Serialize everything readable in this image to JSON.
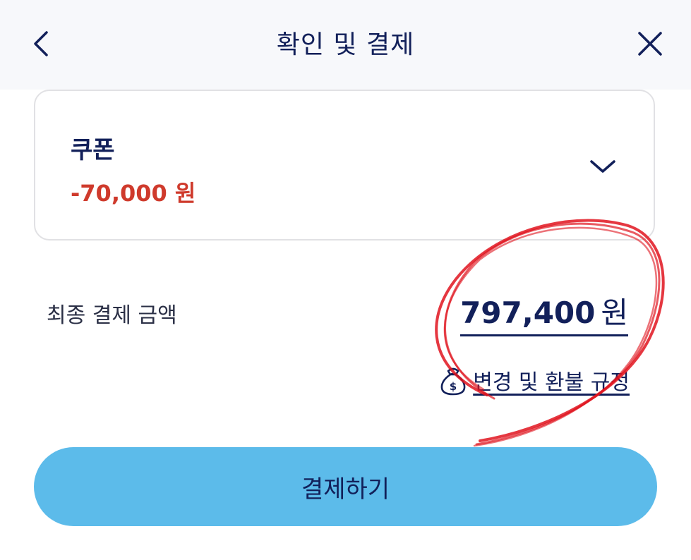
{
  "header": {
    "title": "확인 및 결제",
    "back_icon": "chevron-left-icon",
    "close_icon": "close-icon"
  },
  "coupon": {
    "label": "쿠폰",
    "amount": "-70,000 원",
    "expand_icon": "chevron-down-icon"
  },
  "total": {
    "label": "최종 결제 금액",
    "amount": "797,400",
    "unit": "원"
  },
  "policy": {
    "icon": "money-bag-icon",
    "label": "변경 및 환불 규정"
  },
  "pay_button": {
    "label": "결제하기"
  },
  "colors": {
    "navy": "#12205a",
    "discount_red": "#cf3a2c",
    "pay_button_blue": "#5cbbea",
    "header_bg": "#f7f8fb",
    "annotation_red": "#e0141e"
  }
}
